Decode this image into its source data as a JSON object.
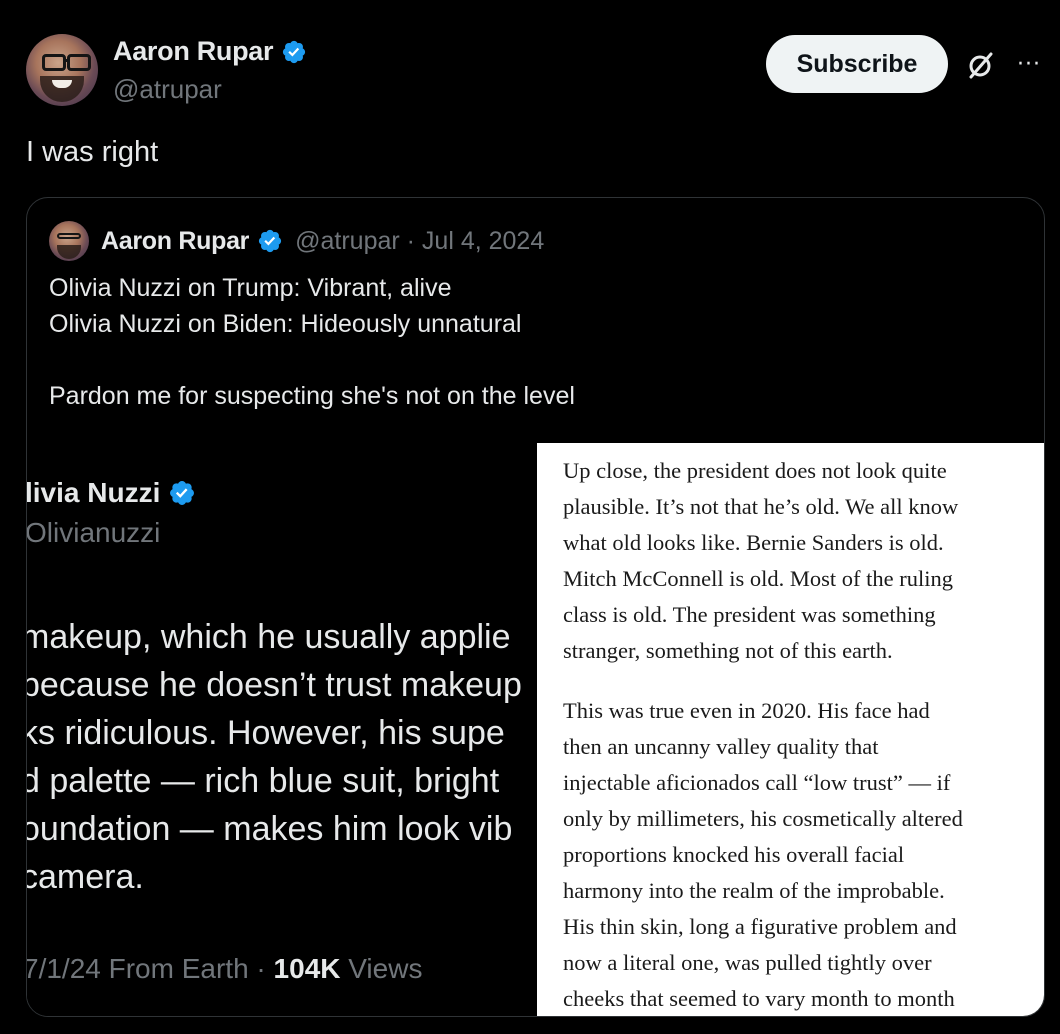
{
  "post": {
    "author_name": "Aaron Rupar",
    "author_handle": "@atrupar",
    "subscribe_label": "Subscribe",
    "more_label": "···",
    "text": "I was right"
  },
  "quoted": {
    "author_name": "Aaron Rupar",
    "meta": "@atrupar · Jul 4, 2024",
    "lines": [
      "Olivia Nuzzi on Trump: Vibrant, alive",
      "Olivia Nuzzi on Biden: Hideously unnatural",
      "",
      "Pardon me for suspecting she's not on the level"
    ]
  },
  "media_left": {
    "name": "livia Nuzzi",
    "handle": "Olivianuzzi",
    "lines": [
      " makeup, which he usually applie",
      "because he doesn’t trust makeup",
      "ks ridiculous. However, his supe",
      "d palette — rich blue suit, bright",
      "oundation — makes him look vib",
      "camera."
    ],
    "footer_date": "7/1/24 From Earth · ",
    "footer_views_count": "104K",
    "footer_views_label": " Views"
  },
  "media_right": {
    "paragraphs": [
      [
        "Up close, the president does not look quite",
        "plausible. It’s not that he’s old. We all know",
        "what old looks like. Bernie Sanders is old.",
        "Mitch McConnell is old. Most of the ruling",
        "class is old. The president was something",
        "stranger, something not of this earth."
      ],
      [
        "This was true even in 2020. His face had",
        "then an uncanny valley quality that",
        "injectable aficionados call “low trust” — if",
        "only by millimeters, his cosmetically altered",
        "proportions knocked his overall facial",
        "harmony into the realm of the improbable.",
        "His thin skin, long a figurative problem and",
        "now a literal one, was pulled tightly over",
        "cheeks that seemed to vary month to month"
      ]
    ]
  },
  "colors": {
    "background": "#000000",
    "text_primary": "#e7e9ea",
    "text_secondary": "#71767b",
    "verified_blue": "#1d9bf0",
    "border": "#2f3336",
    "subscribe_bg": "#eff3f4"
  },
  "icons": {
    "verified": "verified-badge-icon",
    "grok": "grok-icon",
    "more": "more-icon"
  }
}
